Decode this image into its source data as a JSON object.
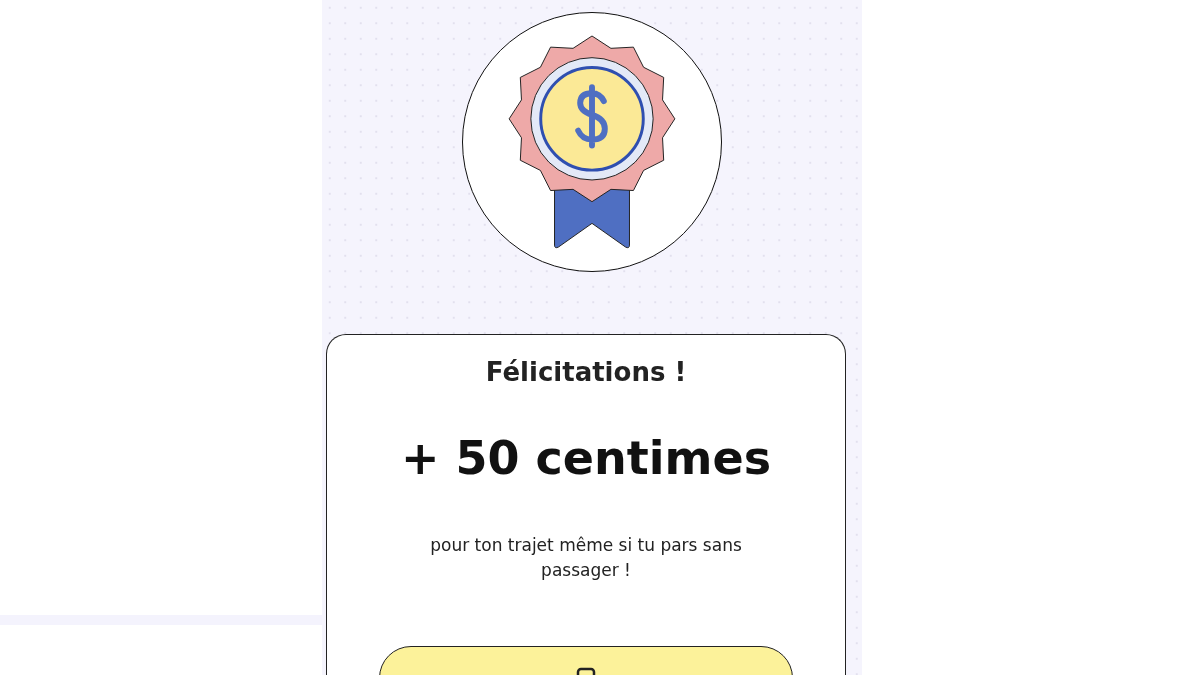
{
  "reward": {
    "title": "Félicitations !",
    "amount": "+ 50 centimes",
    "message": "pour ton trajet même si tu pars sans passager !"
  },
  "action_button": {
    "kind": "primary"
  }
}
